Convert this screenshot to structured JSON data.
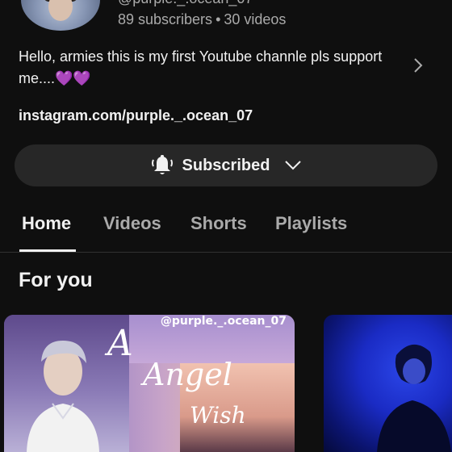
{
  "channel": {
    "handle_partial": "@purple._.ocean_07",
    "subscribers": "89 subscribers",
    "separator": "•",
    "videos": "30 videos",
    "description": "Hello, armies this is my first Youtube channle pls support me....💜💜",
    "link": "instagram.com/purple._.ocean_07"
  },
  "subscribe_button": {
    "label": "Subscribed",
    "icon": "bell-icon"
  },
  "tabs": [
    {
      "label": "Home",
      "active": true
    },
    {
      "label": "Videos",
      "active": false
    },
    {
      "label": "Shorts",
      "active": false
    },
    {
      "label": "Playlists",
      "active": false
    }
  ],
  "section": {
    "title": "For you"
  },
  "videos": [
    {
      "watermark": "@purple._.ocean_07",
      "title_a": "A",
      "title_angel": "Angel",
      "title_wish": "Wish"
    },
    {}
  ],
  "colors": {
    "background": "#0f0f0f",
    "button_bg": "#272727",
    "text_primary": "#f1f1f1",
    "text_secondary": "#aaaaaa"
  }
}
